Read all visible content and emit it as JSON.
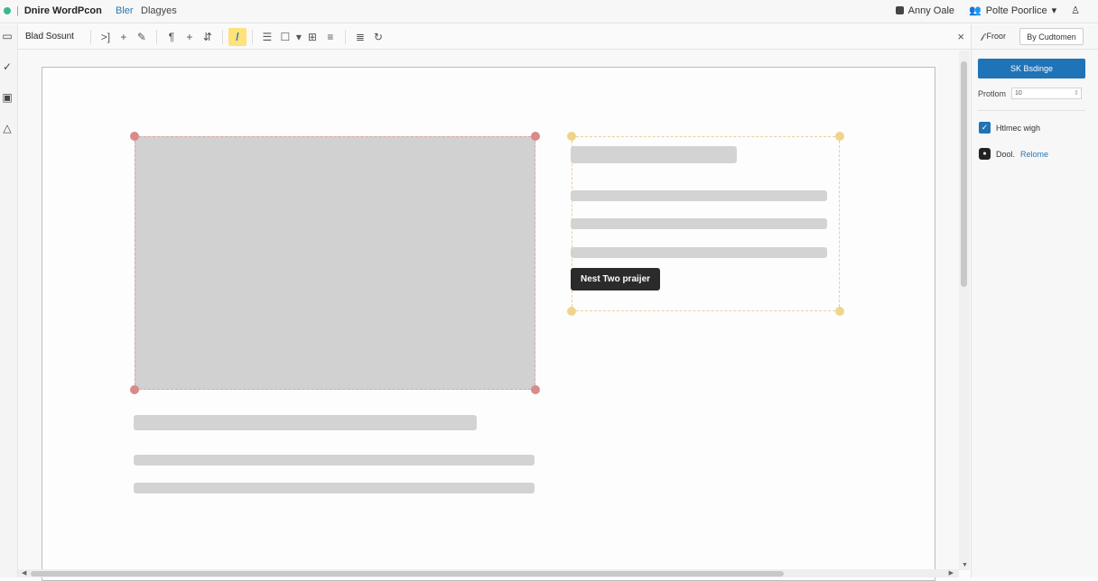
{
  "topbar": {
    "title": "Dnire WordPcon",
    "link_primary": "Bler",
    "link_secondary": "Dlagyes",
    "user": "Anny Oale",
    "profile": "Polte Poorlice",
    "separator": "|"
  },
  "toolbar": {
    "label": "Blad Sosunt",
    "icons": [
      "source-icon",
      "plus-icon",
      "pen-icon",
      "format-icon",
      "add-icon",
      "transform-icon",
      "highlight-icon",
      "list-icon",
      "frame-icon",
      "dropdown-icon",
      "grid-icon",
      "align-icon",
      "menu-icon",
      "refresh-icon"
    ],
    "close_symbol": "×"
  },
  "canvas": {
    "cta_label": "Nest Two praijer"
  },
  "panel": {
    "filter_label": "Froor",
    "custom_button": "By Cudtomen",
    "primary_button": "SK Bsdinge",
    "position_label": "Protlom",
    "position_value": "10",
    "option1_label": "Htlmec wigh",
    "option2_prefix": "Dool.",
    "option2_link": "Relome"
  },
  "colors": {
    "accent": "#1f73b7",
    "handle_image": "#d98a8a",
    "handle_text": "#f0d48a",
    "placeholder": "#d1d1d1"
  }
}
